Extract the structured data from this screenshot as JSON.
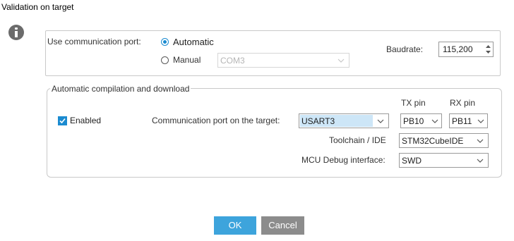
{
  "dialog": {
    "title": "Validation on target"
  },
  "comm": {
    "label": "Use communication port:",
    "automatic_label": "Automatic",
    "manual_label": "Manual",
    "mode": "automatic",
    "port_value": "COM3",
    "baudrate_label": "Baudrate:",
    "baudrate_value": "115,200"
  },
  "autogroup": {
    "legend": "Automatic compilation and download",
    "enabled_label": "Enabled",
    "enabled_checked": true,
    "tx_pin_label": "TX pin",
    "rx_pin_label": "RX pin",
    "target_port_label": "Communication port on the target:",
    "target_port_value": "USART3",
    "tx_pin_value": "PB10",
    "rx_pin_value": "PB11",
    "toolchain_label": "Toolchain / IDE",
    "toolchain_value": "STM32CubeIDE",
    "debug_label": "MCU Debug interface:",
    "debug_value": "SWD"
  },
  "buttons": {
    "ok_label": "OK",
    "cancel_label": "Cancel"
  },
  "icons": {
    "info": "info-icon",
    "chevron": "chevron-down-icon",
    "spinner": "spinner-arrows-icon"
  },
  "colors": {
    "accent": "#1b8bd0",
    "ok_button": "#3da4dc",
    "cancel_button": "#8c8c8c",
    "selection_highlight": "#cde6f7"
  }
}
